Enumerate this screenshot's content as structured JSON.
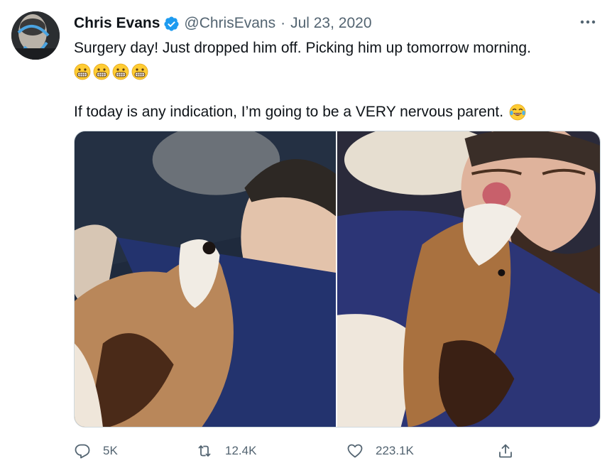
{
  "author": {
    "name": "Chris Evans",
    "handle": "@ChrisEvans",
    "separator": "·",
    "date": "Jul 23, 2020",
    "verified": true,
    "avatar_icon": "profile-photo"
  },
  "tweet": {
    "line1": "Surgery day! Just dropped him off. Picking him up tomorrow morning.",
    "line1_emojis": [
      "grimacing-face-emoji",
      "grimacing-face-emoji",
      "grimacing-face-emoji",
      "grimacing-face-emoji"
    ],
    "line2": "If today is any indication, I’m going to be a VERY nervous parent.",
    "line2_emoji": "face-with-tears-of-joy-emoji"
  },
  "media": {
    "photos": [
      "photo-1",
      "photo-2"
    ]
  },
  "actions": {
    "reply_count": "5K",
    "retweet_count": "12.4K",
    "like_count": "223.1K",
    "share_icon": "share-icon"
  },
  "colors": {
    "text": "#0f1419",
    "secondary": "#536471",
    "verified": "#1d9bf0",
    "border": "#cfd9de",
    "emoji_yellow": "#ffcc33"
  }
}
